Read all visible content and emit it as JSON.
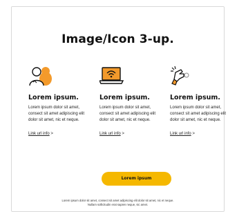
{
  "title": "Image/Icon 3-up.",
  "columns": [
    {
      "icon": "people-icon",
      "heading": "Lorem ipsum.",
      "body": "Lorem ipsum dolor sit amet, consect sit amet adipiscing elit dolor sit amet, nic et neque.",
      "link_text": "Link url info",
      "link_suffix": ">"
    },
    {
      "icon": "laptop-wifi-icon",
      "heading": "Lorem ipsum.",
      "body": "Lorem ipsum dolor sit amet, consect sit amet adipiscing elit dolor sit amet, nic et neque.",
      "link_text": "Link url info",
      "link_suffix": ">"
    },
    {
      "icon": "hand-swipe-icon",
      "heading": "Lorem ipsum.",
      "body": "Lorem ipsum dolor sit amet, consect sit amet adipiscing elit dolor sit amet, nic et neque.",
      "link_text": "Link url info",
      "link_suffix": ">"
    }
  ],
  "cta_label": "Lorem ipsum",
  "footnote_line1": "Lorem ipsum dolor sit amet, consect sit amet adipiscing elit dolor sit amet, nic et neque.",
  "footnote_line2": "Nullam sollicitudin erat sapien neque, sic amet.",
  "colors": {
    "accent": "#f5b800",
    "orange": "#f39a2b",
    "text": "#111111"
  }
}
